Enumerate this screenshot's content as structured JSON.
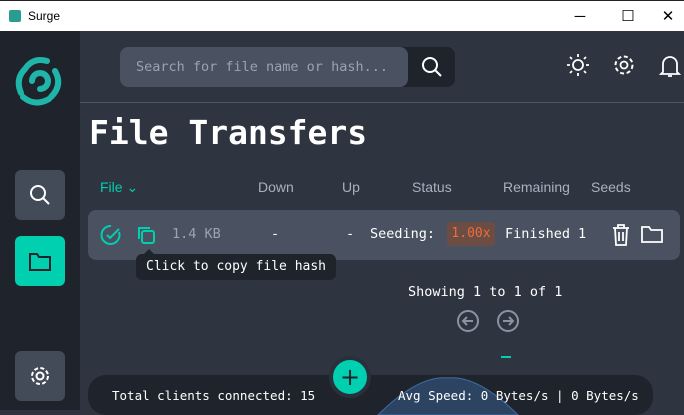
{
  "window": {
    "title": "Surge",
    "minimize": "─",
    "maximize": "☐",
    "close": "✕"
  },
  "search": {
    "placeholder": "Search for file name or hash..."
  },
  "page_title": "File Transfers",
  "columns": {
    "file": "File",
    "down": "Down",
    "up": "Up",
    "status": "Status",
    "remaining": "Remaining",
    "seeds": "Seeds"
  },
  "row": {
    "size": "1.4 KB",
    "down": "-",
    "up": "-",
    "status_label": "Seeding:",
    "ratio": "1.00x",
    "remaining": "Finished",
    "seeds": "1"
  },
  "tooltip": "Click to copy file hash",
  "pagination": {
    "showing": "Showing 1 to 1 of 1"
  },
  "footer": {
    "clients": "Total clients connected: 15",
    "speed": "Avg Speed: 0 Bytes/s | 0 Bytes/s",
    "add": "+"
  },
  "colors": {
    "accent": "#00cfb0",
    "ratio": "#ef6c3a"
  }
}
